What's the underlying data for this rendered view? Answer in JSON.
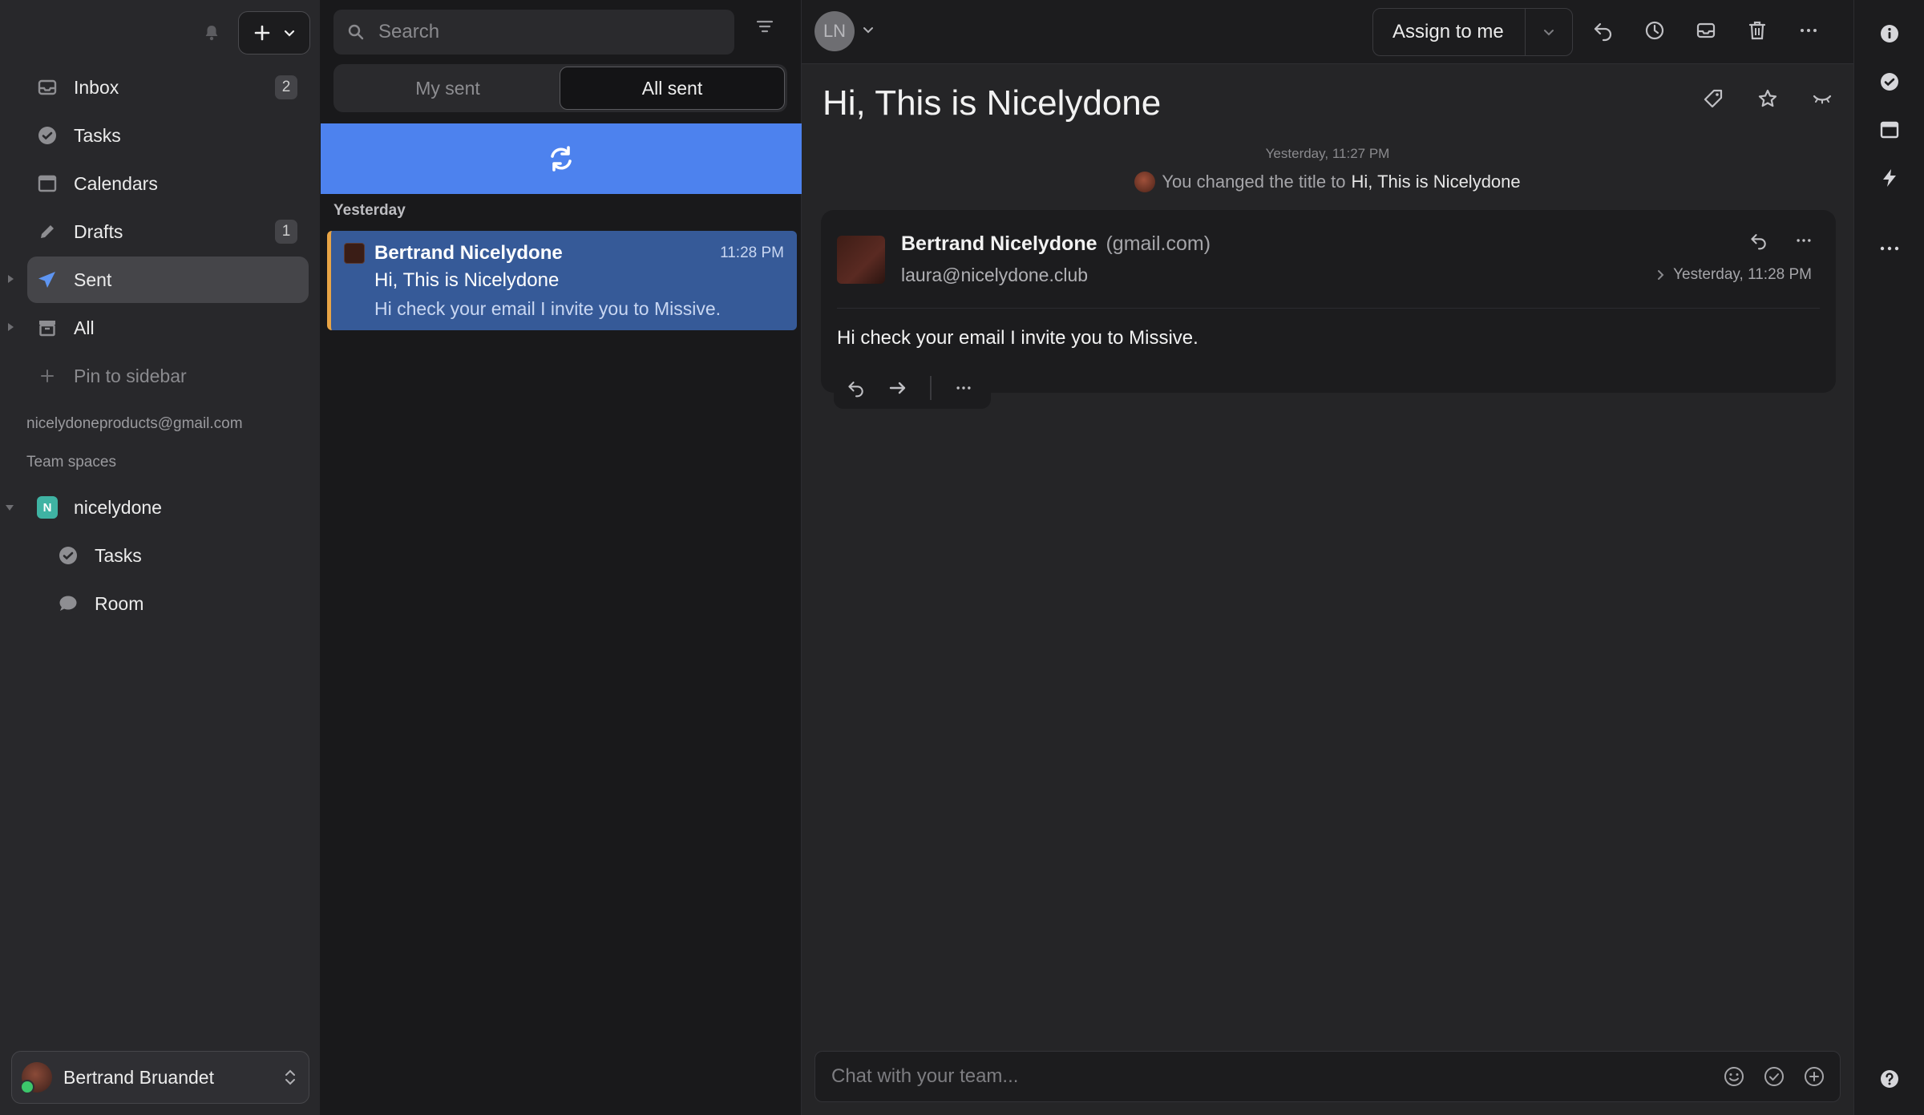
{
  "sidebar": {
    "items": [
      {
        "label": "Inbox",
        "badge": "2",
        "icon": "inbox-icon"
      },
      {
        "label": "Tasks",
        "badge": "",
        "icon": "check-circle-icon"
      },
      {
        "label": "Calendars",
        "badge": "",
        "icon": "calendar-icon"
      },
      {
        "label": "Drafts",
        "badge": "1",
        "icon": "pencil-icon"
      },
      {
        "label": "Sent",
        "badge": "",
        "icon": "paper-plane-icon"
      },
      {
        "label": "All",
        "badge": "",
        "icon": "archive-icon"
      }
    ],
    "pin_label": "Pin to sidebar",
    "account_email": "nicelydoneproducts@gmail.com",
    "team_spaces_label": "Team spaces",
    "team": {
      "name": "nicelydone",
      "badge": "N",
      "items": [
        {
          "label": "Tasks"
        },
        {
          "label": "Room"
        }
      ]
    },
    "profile_name": "Bertrand Bruandet"
  },
  "list": {
    "search_placeholder": "Search",
    "tabs": [
      "My sent",
      "All sent"
    ],
    "active_tab": "All sent",
    "group_label": "Yesterday",
    "messages": [
      {
        "from": "Bertrand Nicelydone",
        "time": "11:28 PM",
        "subject": "Hi, This is Nicelydone",
        "preview": "Hi check your email I invite you to Missive."
      }
    ]
  },
  "conversation": {
    "assignee_initials": "LN",
    "assign_label": "Assign to me",
    "title": "Hi, This is Nicelydone",
    "event_time": "Yesterday, 11:27 PM",
    "event_text": "You changed the title to",
    "event_value": "Hi, This is Nicelydone",
    "email": {
      "from_name": "Bertrand Nicelydone",
      "from_domain": "(gmail.com)",
      "to": "laura@nicelydone.club",
      "date": "Yesterday, 11:28 PM",
      "body": "Hi check your email I invite you to Missive."
    },
    "chat_placeholder": "Chat with your team..."
  },
  "colors": {
    "accent": "#4d82ee",
    "selected_row": "#365a98",
    "unread_marker": "#e8a445",
    "team_badge": "#3fb3a3"
  }
}
